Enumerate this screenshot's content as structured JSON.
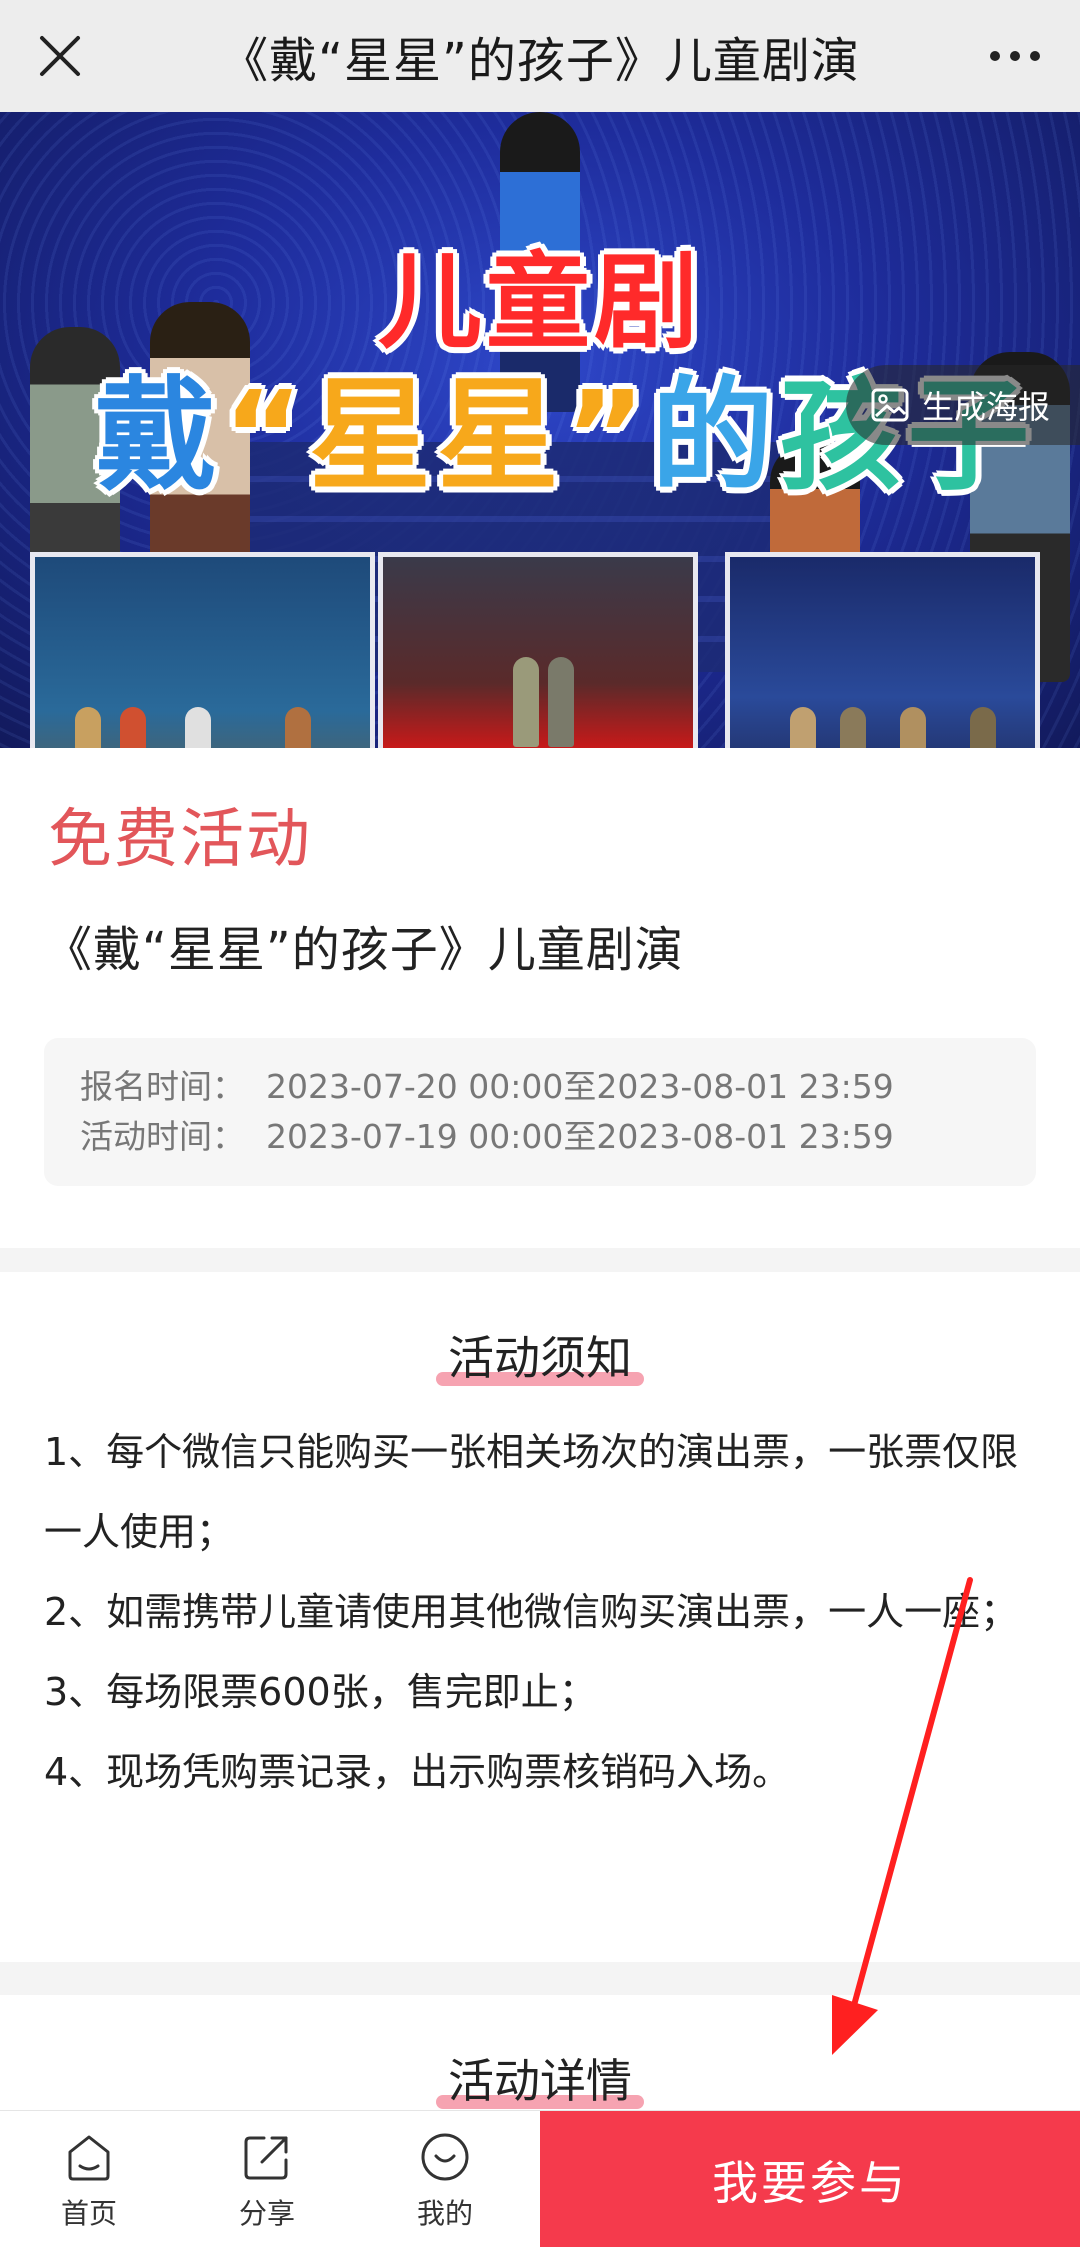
{
  "navbar": {
    "title": "《戴“星星”的孩子》儿童剧演"
  },
  "banner": {
    "title_line1": "儿童剧",
    "title_line2_parts": [
      "戴",
      "“星星”",
      "的",
      "孩子"
    ],
    "poster_button_label": "生成海报"
  },
  "activity": {
    "price_label": "免费活动",
    "title": "《戴“星星”的孩子》儿童剧演",
    "registration_label": "报名时间：",
    "registration_time": "2023-07-20 00:00至2023-08-01 23:59",
    "event_label": "活动时间：",
    "event_time": "2023-07-19 00:00至2023-08-01 23:59"
  },
  "notice": {
    "heading": "活动须知",
    "items": [
      "1、每个微信只能购买一张相关场次的演出票，一张票仅限一人使用；",
      "2、如需携带儿童请使用其他微信购买演出票，一人一座；",
      "3、每场限票600张，售完即止；",
      "4、现场凭购票记录，出示购票核销码入场。"
    ]
  },
  "detail": {
    "heading": "活动详情"
  },
  "tabbar": {
    "home_label": "首页",
    "share_label": "分享",
    "mine_label": "我的",
    "join_label": "我要参与"
  },
  "colors": {
    "accent_red": "#f53a4c",
    "free_label": "#e2565a",
    "highlight_pink": "#f6a3b1",
    "arrow": "#ff2020"
  }
}
